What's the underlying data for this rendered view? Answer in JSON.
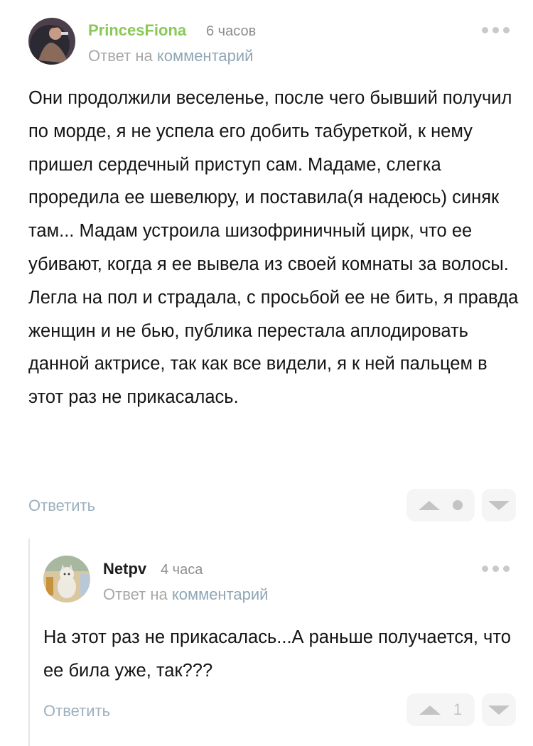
{
  "comments": [
    {
      "author": "PrincesFiona",
      "time": "6 часов",
      "reply_prefix": "Ответ на",
      "reply_link": "комментарий",
      "text": "Они продолжили веселенье, после чего бывший получил по морде, я не успела его добить табуреткой, к нему пришел сердечный приступ сам. Мадаме, слегка проредила ее шевелюру, и поставила(я надеюсь) синяк там... Мадам устроила шизофриничный цирк, что ее убивают, когда я ее вывела из своей комнаты за волосы. Легла на пол и страдала, с просьбой ее не бить, я правда женщин и не бью, публика перестала аплодировать данной актрисе, так как все видели, я к ней пальцем в этот раз не прикасалась.",
      "reply_button": "Ответить",
      "rating": ""
    },
    {
      "author": "Netpv",
      "time": "4 часа",
      "reply_prefix": "Ответ на",
      "reply_link": "комментарий",
      "text": "На этот раз не прикасалась...А раньше получается, что ее била уже, так???",
      "reply_button": "Ответить",
      "rating": "1"
    }
  ],
  "colors": {
    "author_accent": "#8ac858",
    "link": "#8fa6b5",
    "muted": "#a8a8a8"
  }
}
